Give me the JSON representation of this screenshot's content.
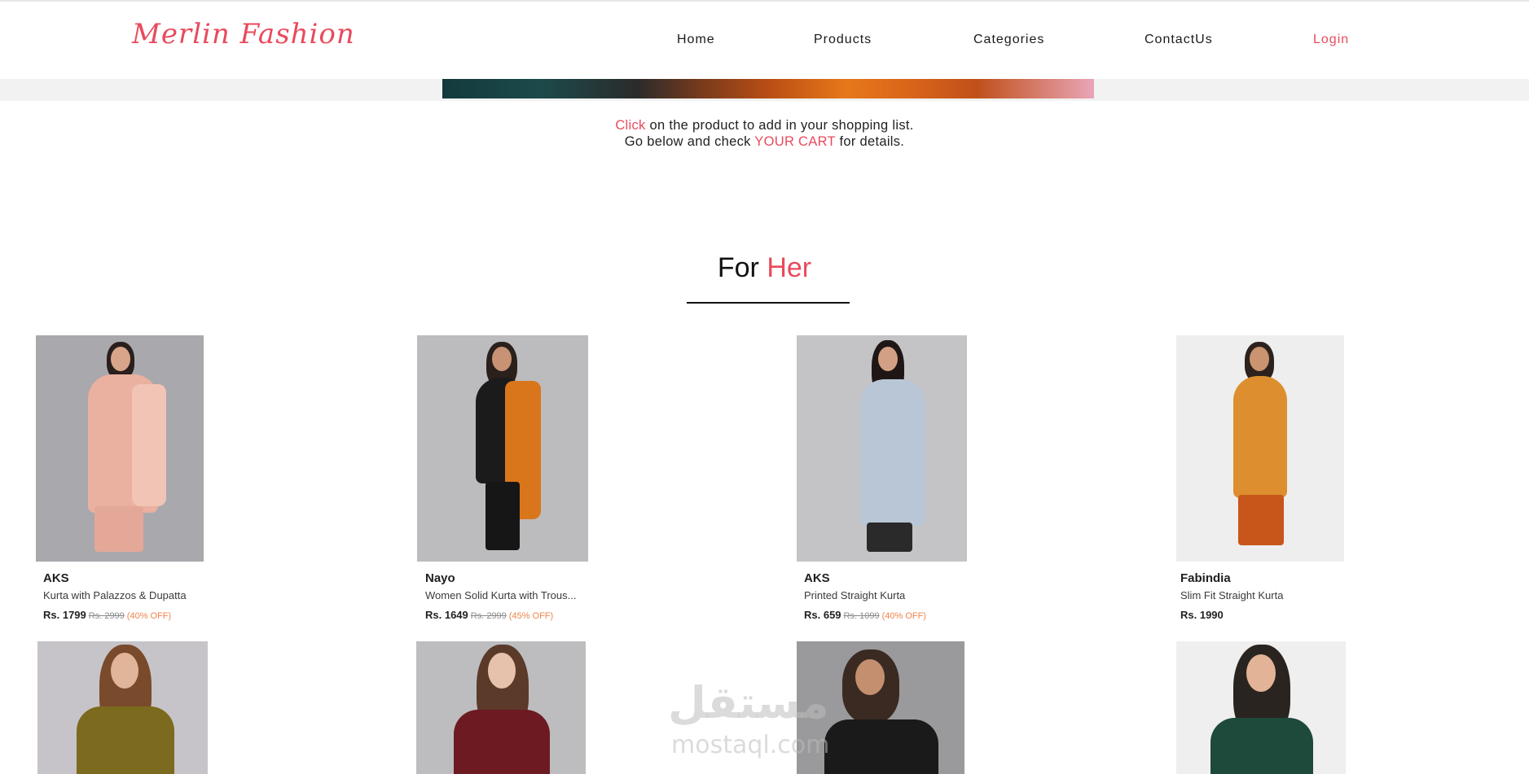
{
  "header": {
    "logo": "Merlin Fashion",
    "nav": {
      "home": "Home",
      "products": "Products",
      "categories": "Categories",
      "contact": "ContactUs",
      "login": "Login"
    }
  },
  "instructions": {
    "click": "Click",
    "line1_rest": "on the product to add in your shopping list.",
    "line2_pre": "Go below and check",
    "your_cart": "YOUR CART",
    "line2_post": "for details."
  },
  "section": {
    "title_part1": "For",
    "title_part2": "Her"
  },
  "products": [
    {
      "brand": "AKS",
      "name": "Kurta with Palazzos & Dupatta",
      "price": "Rs. 1799",
      "was": "Rs. 2999",
      "off": "(40% OFF)"
    },
    {
      "brand": "Nayo",
      "name": "Women Solid Kurta with Trous...",
      "price": "Rs. 1649",
      "was": "Rs. 2999",
      "off": "(45% OFF)"
    },
    {
      "brand": "AKS",
      "name": "Printed Straight Kurta",
      "price": "Rs. 659",
      "was": "Rs. 1099",
      "off": "(40% OFF)"
    },
    {
      "brand": "Fabindia",
      "name": "Slim Fit Straight Kurta",
      "price": "Rs. 1990",
      "was": "",
      "off": ""
    }
  ],
  "watermark": {
    "arabic": "مستقل",
    "latin": "mostaql.com"
  },
  "colors": {
    "accent": "#e94a5c",
    "discount": "#f0844a",
    "text": "#111111"
  }
}
